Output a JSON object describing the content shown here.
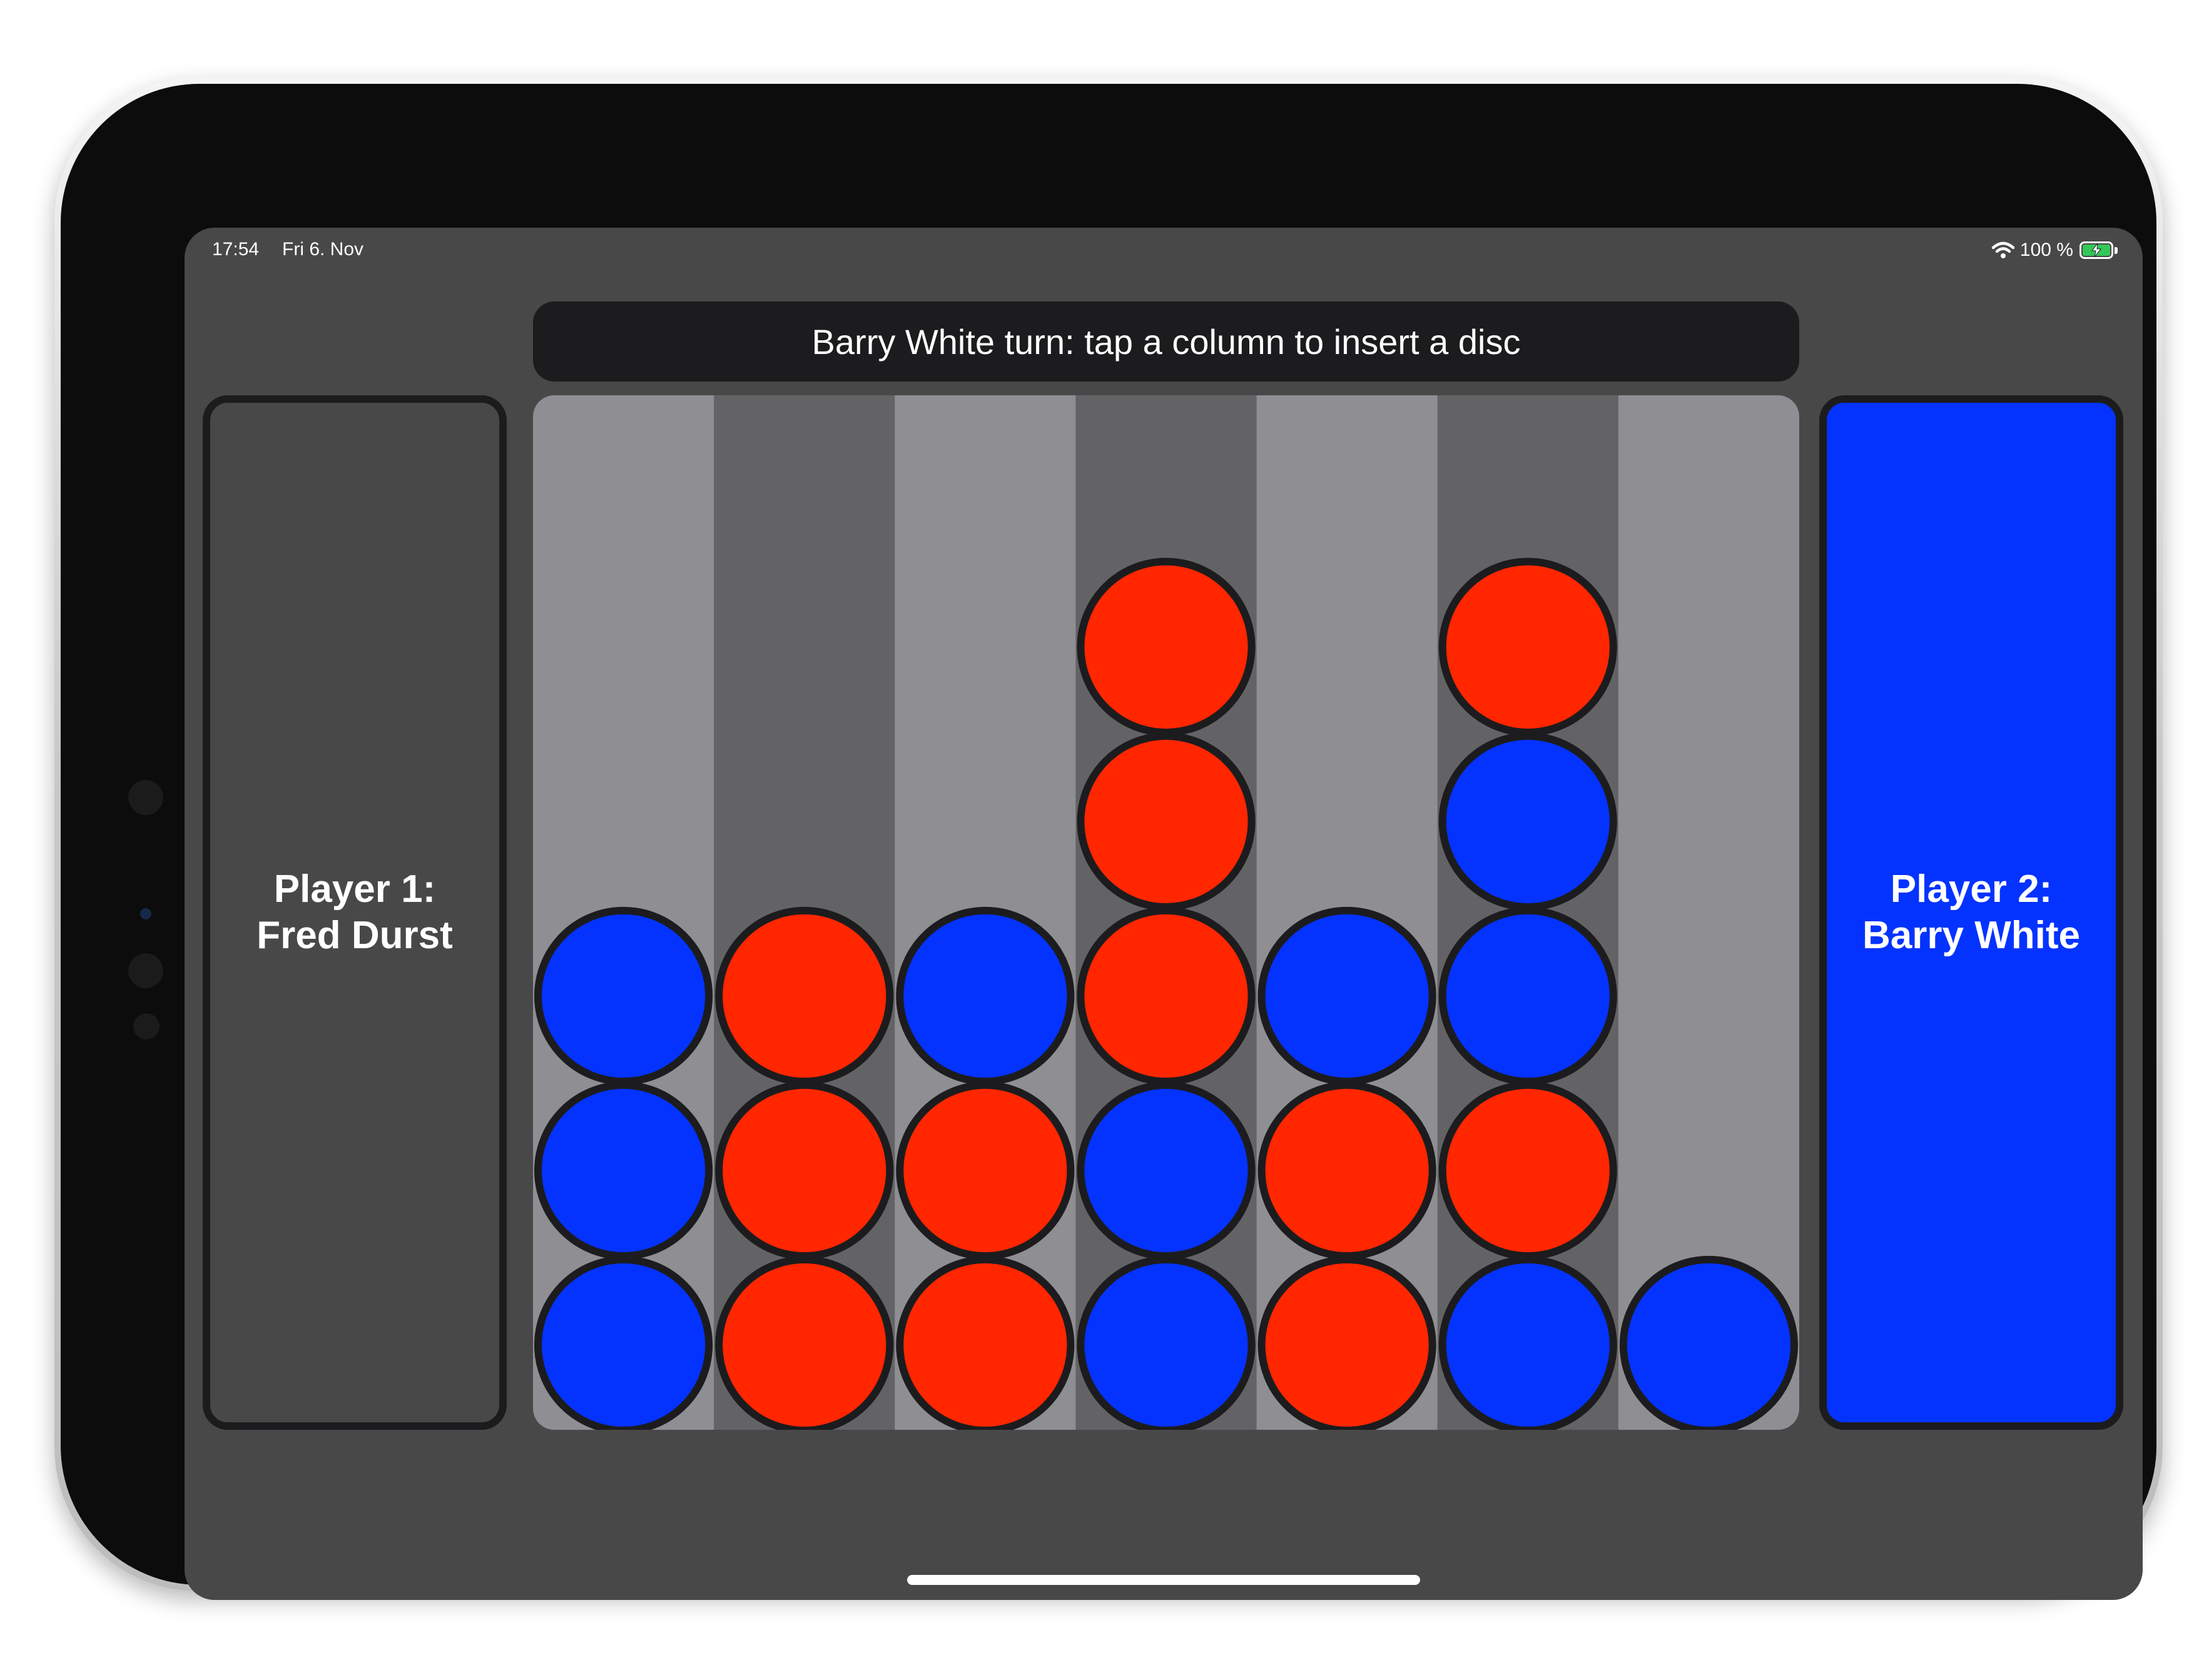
{
  "status_bar": {
    "time": "17:54",
    "date": "Fri 6. Nov",
    "battery_text": "100 %",
    "icons": [
      "wifi-icon",
      "battery-charging-icon"
    ]
  },
  "banner": {
    "text": "Barry White turn: tap a column to insert a disc"
  },
  "player1": {
    "line1": "Player 1:",
    "line2": "Fred Durst",
    "color": "#484848"
  },
  "player2": {
    "line1": "Player 2:",
    "line2": "Barry White",
    "color": "#0433ff"
  },
  "board": {
    "columns": 7,
    "rows": 6,
    "column_colors": [
      "#8e8e93",
      "#636366",
      "#8e8e93",
      "#636366",
      "#8e8e93",
      "#636366",
      "#8e8e93"
    ],
    "disc_colors": {
      "red": "#ff2600",
      "blue": "#0433ff",
      "outline": "#1c1c1e"
    },
    "columns_bottom_up": [
      [
        "blue",
        "blue",
        "blue"
      ],
      [
        "red",
        "red",
        "red"
      ],
      [
        "red",
        "red",
        "blue"
      ],
      [
        "blue",
        "blue",
        "red",
        "red",
        "red"
      ],
      [
        "red",
        "red",
        "blue"
      ],
      [
        "blue",
        "red",
        "blue",
        "blue",
        "red"
      ],
      [
        "blue"
      ]
    ]
  }
}
